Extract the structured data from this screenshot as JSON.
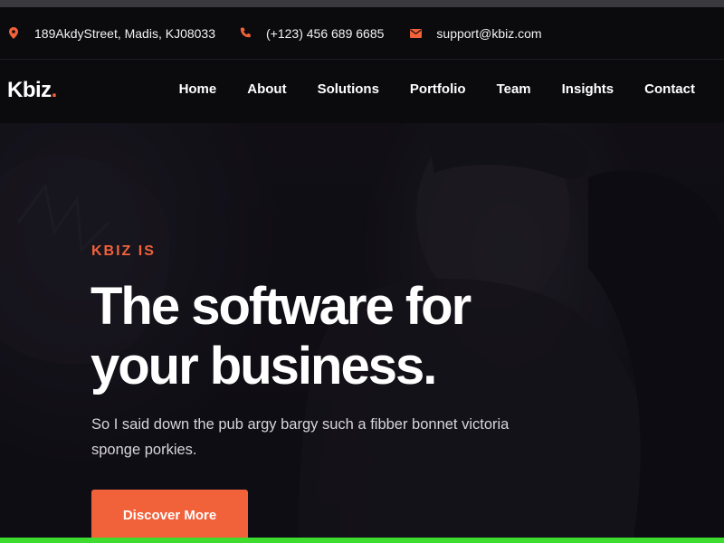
{
  "topbar": {
    "address": "189AkdyStreet, Madis, KJ08033",
    "phone": "(+123) 456 689 6685",
    "email": "support@kbiz.com",
    "icons": {
      "address": "map-pin-icon",
      "phone": "phone-icon",
      "email": "envelope-icon"
    }
  },
  "brand": {
    "name": "Kbiz",
    "dot": ".",
    "accent": "#f1623b"
  },
  "nav": {
    "items": [
      "Home",
      "About",
      "Solutions",
      "Portfolio",
      "Team",
      "Insights",
      "Contact"
    ]
  },
  "hero": {
    "eyebrow": "KBIZ IS",
    "headline": "The software for your business.",
    "subtext": "So I said down the pub argy bargy such a fibber bonnet victoria sponge porkies.",
    "cta_label": "Discover More"
  }
}
